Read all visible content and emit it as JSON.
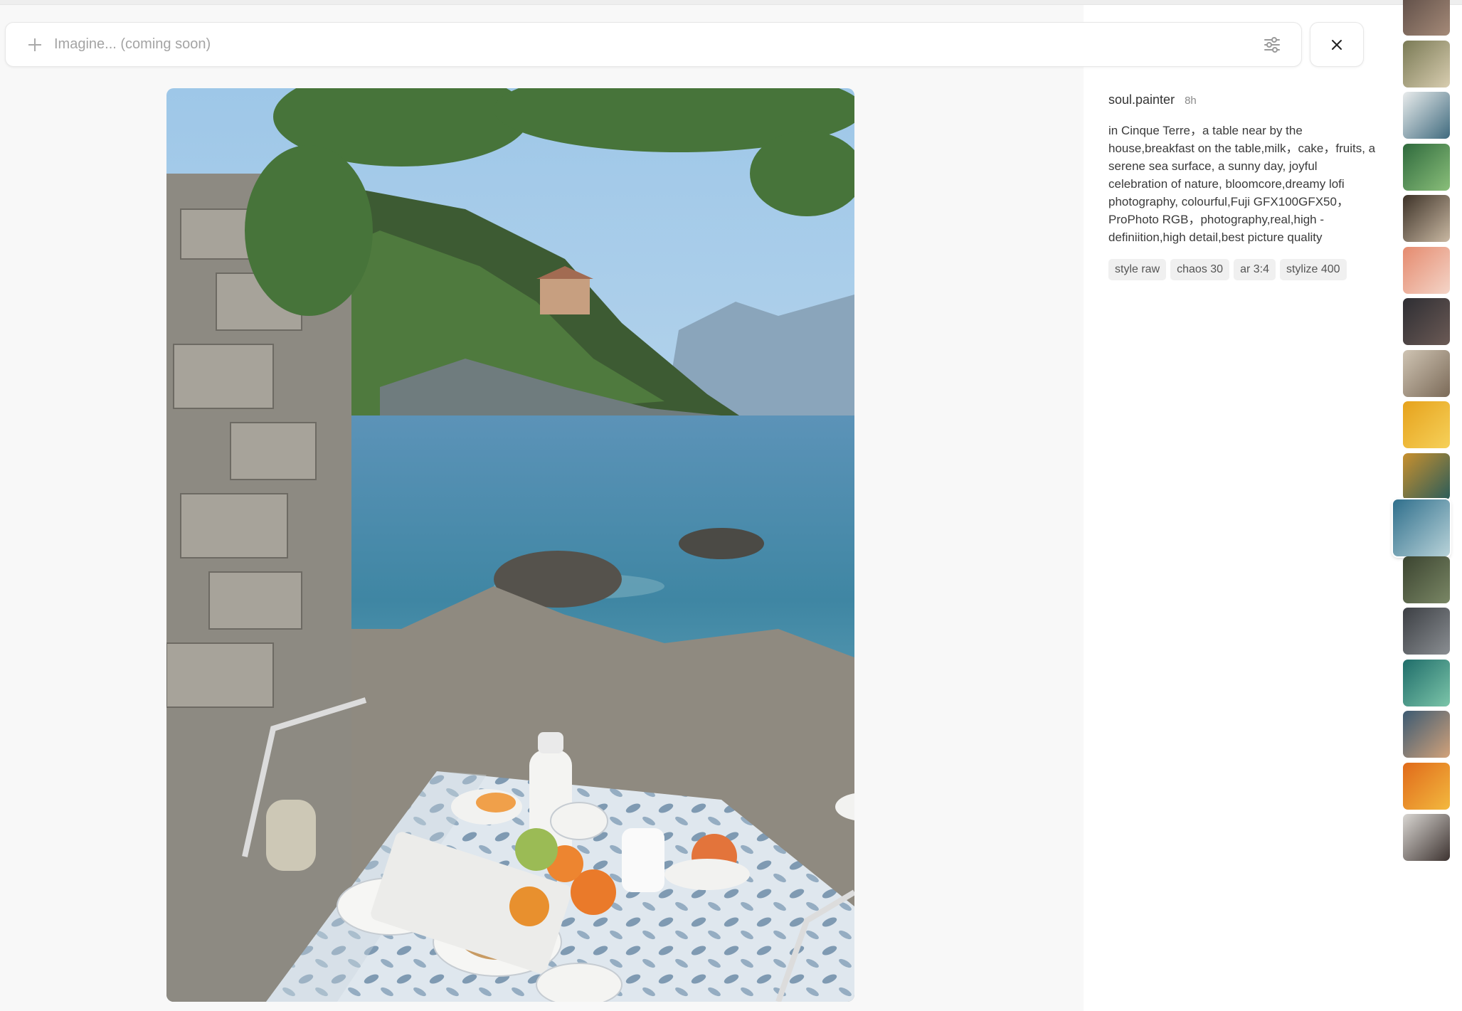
{
  "search": {
    "placeholder": "Imagine... (coming soon)",
    "value": ""
  },
  "post": {
    "author": "soul.painter",
    "age": "8h",
    "prompt": "in Cinque Terre，a table near by the house,breakfast on the table,milk，cake，fruits, a serene sea surface, a sunny day, joyful celebration of nature, bloomcore,dreamy lofi photography, colourful,Fuji GFX100GFX50，ProPhoto RGB，photography,real,high - definiition,high detail,best picture quality",
    "tags": [
      "style raw",
      "chaos 30",
      "ar 3:4",
      "stylize 400"
    ]
  },
  "icons": {
    "add": "plus-icon",
    "settings": "sliders-icon",
    "close": "close-icon"
  },
  "thumbnails": [
    {
      "name": "thumb-dog-portrait",
      "colors": [
        "#5a4a44",
        "#a58a78"
      ]
    },
    {
      "name": "thumb-child-lamb",
      "colors": [
        "#7a7a55",
        "#d8cdb0"
      ]
    },
    {
      "name": "thumb-person-jeans",
      "colors": [
        "#e9ecec",
        "#3f6a7e"
      ]
    },
    {
      "name": "thumb-green-field",
      "colors": [
        "#2f6a3d",
        "#8abf7a"
      ]
    },
    {
      "name": "thumb-black-dog",
      "colors": [
        "#3d3228",
        "#c9b8a2"
      ]
    },
    {
      "name": "thumb-pink-pattern",
      "colors": [
        "#e58a6e",
        "#f4d5c8"
      ]
    },
    {
      "name": "thumb-dark-car",
      "colors": [
        "#2e2e33",
        "#6b5a55"
      ]
    },
    {
      "name": "thumb-interior-room",
      "colors": [
        "#cfc4b3",
        "#7b6a58"
      ]
    },
    {
      "name": "thumb-yellow-cheese",
      "colors": [
        "#e6a21c",
        "#f6d15a"
      ]
    },
    {
      "name": "thumb-bird-branch",
      "colors": [
        "#c8902e",
        "#2a5c5a"
      ]
    },
    {
      "name": "thumb-seaside-active",
      "colors": [
        "#2f6f8c",
        "#b9d3d9"
      ]
    },
    {
      "name": "thumb-soldier",
      "colors": [
        "#3b4430",
        "#7a8765"
      ]
    },
    {
      "name": "thumb-black-cat",
      "colors": [
        "#3c3f44",
        "#8a8e92"
      ]
    },
    {
      "name": "thumb-teal-plant",
      "colors": [
        "#1f6d6a",
        "#7cc5a9"
      ]
    },
    {
      "name": "thumb-girl-flowers",
      "colors": [
        "#3c5a72",
        "#d2a27a"
      ]
    },
    {
      "name": "thumb-orange-face",
      "colors": [
        "#e06a1a",
        "#f3b93f"
      ]
    },
    {
      "name": "thumb-animal-hat",
      "colors": [
        "#d9d6d2",
        "#3d3330"
      ]
    }
  ],
  "active_thumbnail": 10,
  "colors": {
    "background": "#f8f8f8",
    "panel": "#ffffff",
    "tag_bg": "#f0f0f0",
    "muted_text": "#8a8a8a"
  }
}
